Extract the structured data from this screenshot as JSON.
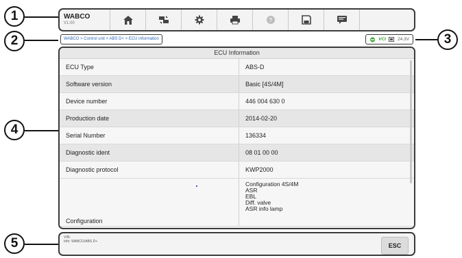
{
  "callouts": [
    "1",
    "2",
    "3",
    "4",
    "5"
  ],
  "toolbar": {
    "brand": "WABCO",
    "version": "V1.00",
    "tools": [
      "home-icon",
      "vehicle-swap-icon",
      "settings-icon",
      "print-icon",
      "help-icon",
      "save-icon",
      "data-log-icon"
    ]
  },
  "breadcrumb": "WABCO > Control unit > ABS D+ > ECU information",
  "status": {
    "vci_label": "VCI",
    "voltage": "24.3V"
  },
  "table": {
    "title": "ECU Information",
    "rows": [
      {
        "label": "ECU Type",
        "value": "ABS-D"
      },
      {
        "label": "Software version",
        "value": "Basic [4S/4M]"
      },
      {
        "label": "Device number",
        "value": "446 004 630 0"
      },
      {
        "label": "Production date",
        "value": "2014-02-20"
      },
      {
        "label": "Serial Number",
        "value": "136334"
      },
      {
        "label": "Diagnostic ident",
        "value": "08 01 00 00"
      },
      {
        "label": "Diagnostic protocol",
        "value": "KWP2000"
      }
    ],
    "config_label": "Configuration",
    "config_values": [
      "Configuration 4S/4M",
      "ASR",
      "EBL",
      "Diff. valve",
      "ASR info lamp"
    ]
  },
  "footer": {
    "vin_label": "VIN:",
    "info_label": "Info: WABCO/ABS D+",
    "esc_label": "ESC"
  },
  "colors": {
    "link": "#2a66b8",
    "vci_green": "#3aa335",
    "frame": "#3a3a3a"
  }
}
